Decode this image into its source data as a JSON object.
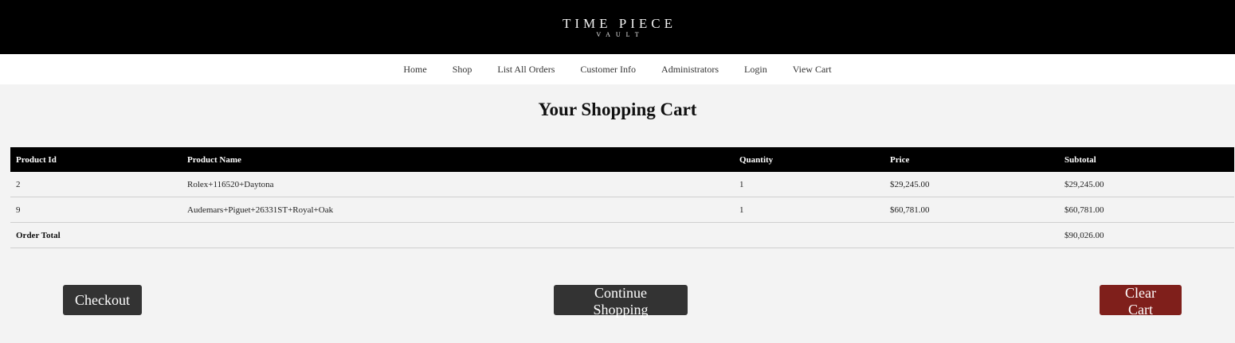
{
  "brand": {
    "name": "TIME PIECE",
    "tagline": "VAULT"
  },
  "nav": {
    "items": [
      "Home",
      "Shop",
      "List All Orders",
      "Customer Info",
      "Administrators",
      "Login",
      "View Cart"
    ]
  },
  "page": {
    "title": "Your Shopping Cart"
  },
  "cart": {
    "columns": [
      "Product Id",
      "Product Name",
      "Quantity",
      "Price",
      "Subtotal"
    ],
    "rows": [
      {
        "id": "2",
        "name": "Rolex+116520+Daytona",
        "quantity": "1",
        "price": "$29,245.00",
        "subtotal": "$29,245.00"
      },
      {
        "id": "9",
        "name": "Audemars+Piguet+26331ST+Royal+Oak",
        "quantity": "1",
        "price": "$60,781.00",
        "subtotal": "$60,781.00"
      }
    ],
    "total_label": "Order Total",
    "total_value": "$90,026.00"
  },
  "buttons": {
    "checkout": "Checkout",
    "continue_shopping": "Continue Shopping",
    "clear_cart": "Clear Cart"
  },
  "colors": {
    "header_bg": "#000000",
    "page_bg": "#f3f3f3",
    "button_dark": "#333333",
    "button_danger": "#7f1f1b"
  }
}
